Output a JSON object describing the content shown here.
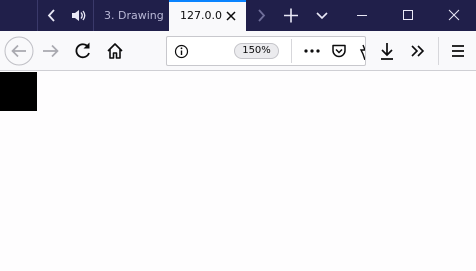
{
  "tabs": [
    {
      "label": "3. Drawing",
      "active": false
    },
    {
      "label": "127.0.0",
      "active": true
    }
  ],
  "urlbar": {
    "zoom": "150%"
  },
  "colors": {
    "tabstrip_bg": "#201f4a",
    "toolbar_bg": "#f9f9fb",
    "accent": "#0a84ff",
    "content_bg": "#fefdfe",
    "content_block": "#000000"
  },
  "icons": [
    "tab-scroll-left-icon",
    "speaker-icon",
    "close-icon",
    "tab-scroll-right-icon",
    "new-tab-icon",
    "tab-list-icon",
    "minimize-icon",
    "maximize-icon",
    "window-close-icon",
    "back-icon",
    "forward-icon",
    "reload-icon",
    "home-icon",
    "page-info-icon",
    "page-actions-icon",
    "pocket-icon",
    "bookmark-star-icon",
    "downloads-icon",
    "overflow-icon",
    "menu-icon"
  ]
}
